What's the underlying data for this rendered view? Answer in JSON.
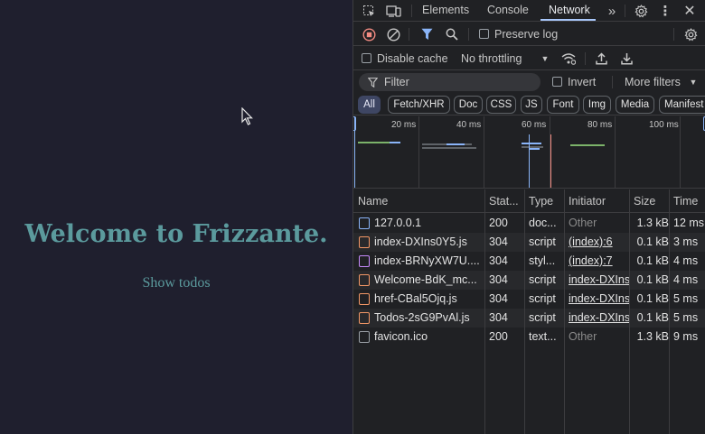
{
  "page": {
    "heading": "Welcome to Frizzante.",
    "link": "Show todos"
  },
  "devtools": {
    "tabs": [
      "Elements",
      "Console",
      "Network"
    ],
    "active_tab": "Network",
    "toolbar": {
      "preserve_log": "Preserve log",
      "disable_cache": "Disable cache",
      "throttling": "No throttling",
      "filter_placeholder": "Filter",
      "invert": "Invert",
      "more_filters": "More filters"
    },
    "chips": [
      "All",
      "Fetch/XHR",
      "Doc",
      "CSS",
      "JS",
      "Font",
      "Img",
      "Media",
      "Manifest"
    ],
    "overview_ticks": [
      "20 ms",
      "40 ms",
      "60 ms",
      "80 ms",
      "100 ms"
    ],
    "columns": [
      "Name",
      "Stat...",
      "Type",
      "Initiator",
      "Size",
      "Time"
    ],
    "rows": [
      {
        "name": "127.0.0.1",
        "status": "200",
        "type": "doc...",
        "initiator": "Other",
        "size": "1.3 kB",
        "time": "12 ms"
      },
      {
        "name": "index-DXIns0Y5.js",
        "status": "304",
        "type": "script",
        "initiator": "(index):6",
        "size": "0.1 kB",
        "time": "3 ms"
      },
      {
        "name": "index-BRNyXW7U....",
        "status": "304",
        "type": "styl...",
        "initiator": "(index):7",
        "size": "0.1 kB",
        "time": "4 ms"
      },
      {
        "name": "Welcome-BdK_mc...",
        "status": "304",
        "type": "script",
        "initiator": "index-DXIns",
        "size": "0.1 kB",
        "time": "4 ms"
      },
      {
        "name": "href-CBal5Ojq.js",
        "status": "304",
        "type": "script",
        "initiator": "index-DXIns",
        "size": "0.1 kB",
        "time": "5 ms"
      },
      {
        "name": "Todos-2sG9PvAl.js",
        "status": "304",
        "type": "script",
        "initiator": "index-DXIns",
        "size": "0.1 kB",
        "time": "5 ms"
      },
      {
        "name": "favicon.ico",
        "status": "200",
        "type": "text...",
        "initiator": "Other",
        "size": "1.3 kB",
        "time": "9 ms"
      }
    ],
    "colors": {
      "doc": "#8ab4f8",
      "script": "#f29766",
      "style": "#c58af9",
      "other": "#9aa0a6",
      "record": "#f28b82"
    }
  }
}
